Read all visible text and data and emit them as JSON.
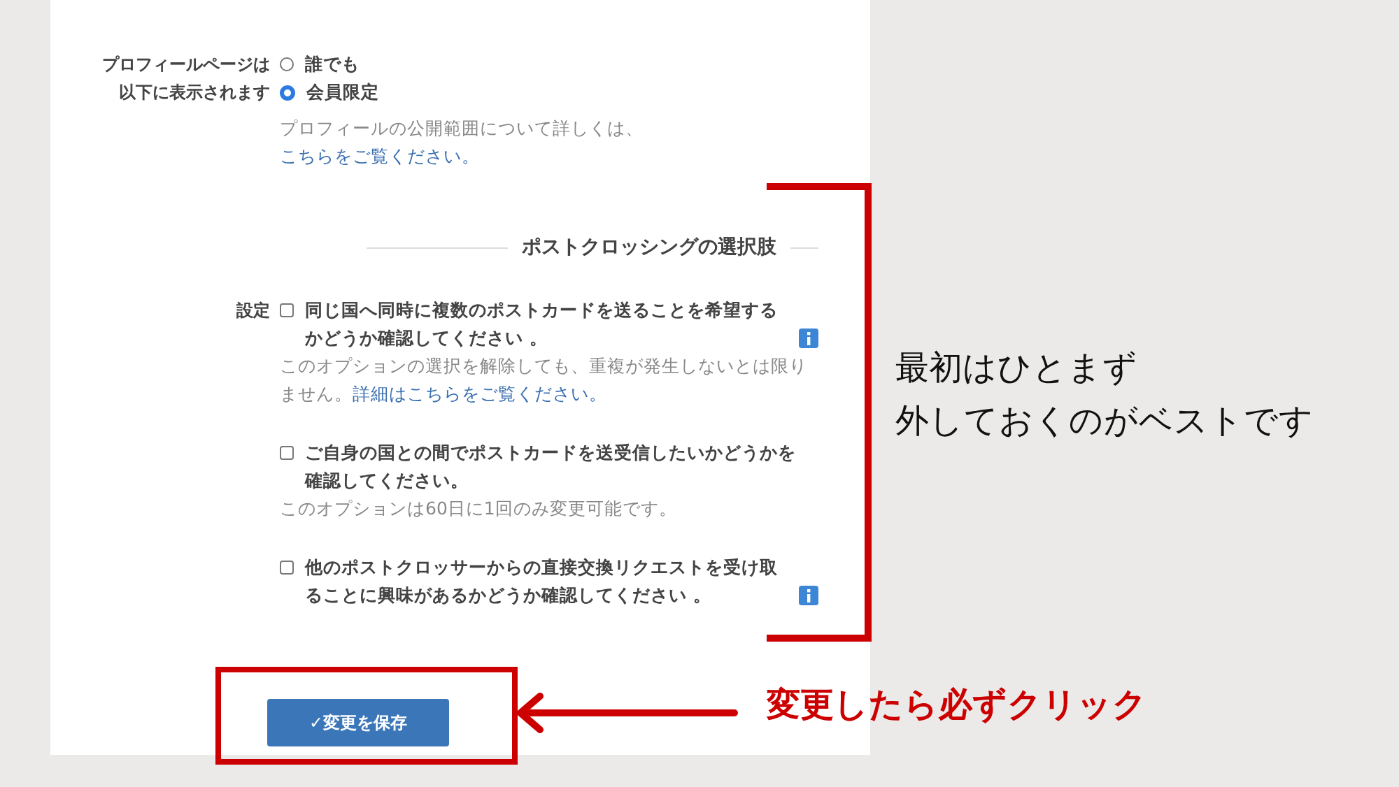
{
  "profile_visibility": {
    "label": "プロフィールページは以下に表示されます",
    "options": [
      {
        "label": "誰でも",
        "selected": false
      },
      {
        "label": "会員限定",
        "selected": true
      }
    ],
    "help": "プロフィールの公開範囲について詳しくは、",
    "help_link": "こちらをご覧ください。"
  },
  "section_title": "ポストクロッシングの選択肢",
  "settings": {
    "label": "設定",
    "options": [
      {
        "label": "同じ国へ同時に複数のポストカードを送ることを希望するかどうか確認してください 。",
        "checked": false,
        "info": true,
        "note": "このオプションの選択を解除しても、重複が発生しないとは限りません。",
        "note_link": "詳細はこちらをご覧ください。"
      },
      {
        "label": "ご自身の国との間でポストカードを送受信したいかどうかを確認してください。",
        "checked": false,
        "info": false,
        "note": "このオプションは60日に1回のみ変更可能です。"
      },
      {
        "label": "他のポストクロッサーからの直接交換リクエストを受け取ることに興味があるかどうか確認してください 。",
        "checked": false,
        "info": true
      }
    ]
  },
  "save_button": "✓変更を保存",
  "annotations": {
    "bracket_note": [
      "最初はひとまず",
      "外しておくのがベストです"
    ],
    "arrow_note": "変更したら必ずクリック"
  }
}
